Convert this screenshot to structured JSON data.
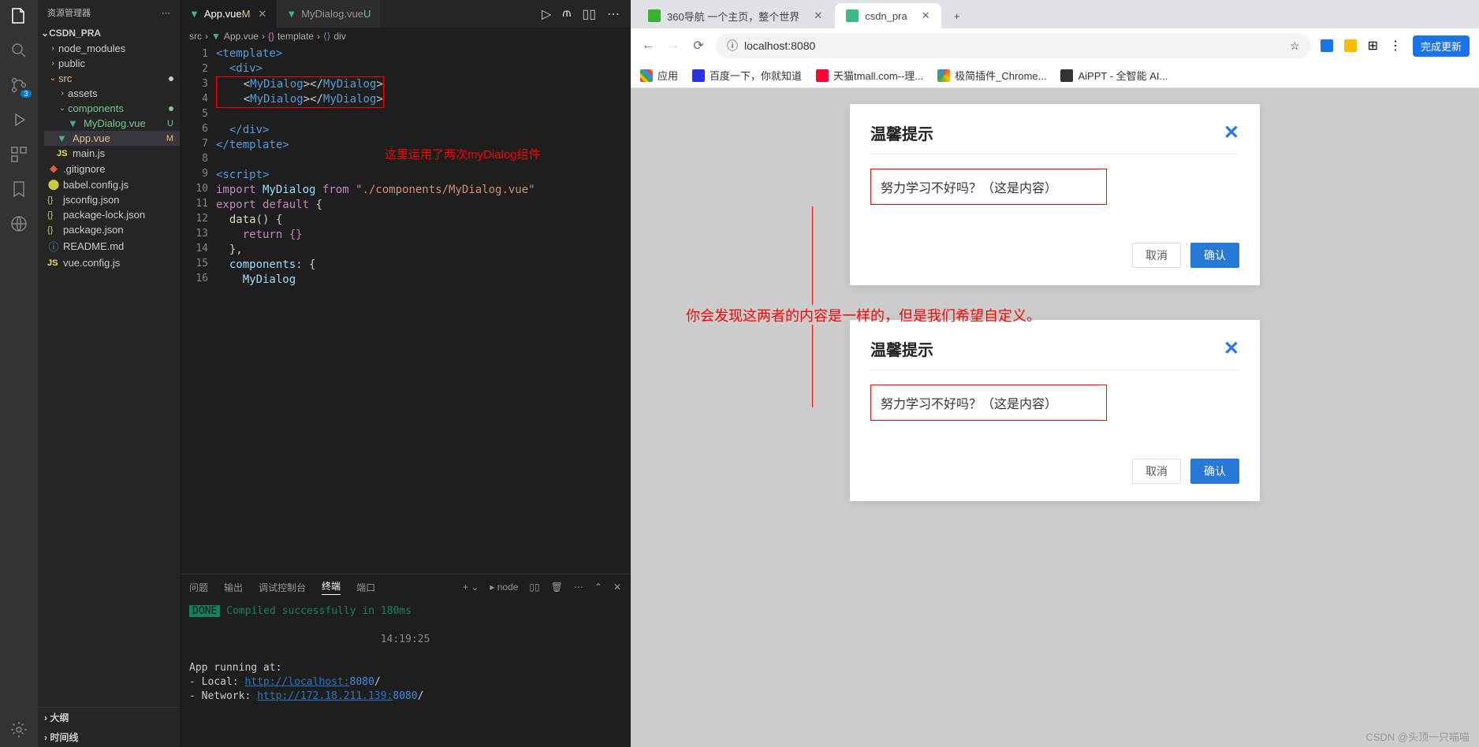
{
  "vscode": {
    "explorer_title": "资源管理器",
    "project_name": "CSDN_PRA",
    "source_control_badge": "3",
    "tree": {
      "node_modules": "node_modules",
      "public": "public",
      "src": "src",
      "assets": "assets",
      "components": "components",
      "mydialog": "MyDialog.vue",
      "mydialog_status": "U",
      "appvue": "App.vue",
      "appvue_status": "M",
      "mainjs": "main.js",
      "gitignore": ".gitignore",
      "babel": "babel.config.js",
      "jsconfig": "jsconfig.json",
      "packagelock": "package-lock.json",
      "packagejson": "package.json",
      "readme": "README.md",
      "vueconfig": "vue.config.js"
    },
    "bottom": {
      "outline": "大纲",
      "timeline": "时间线"
    },
    "tabs": {
      "app": "App.vue",
      "app_status": "M",
      "mydialog": "MyDialog.vue",
      "mydialog_status": "U"
    },
    "breadcrumb": {
      "src": "src",
      "app": "App.vue",
      "tpl": "template",
      "div": "div"
    },
    "code": {
      "l1": "<template>",
      "l2": "  <div>",
      "l3a": "    <",
      "l3b": "MyDialog",
      "l3c": "></",
      "l3d": "MyDialog",
      "l3e": ">",
      "l4a": "    <",
      "l4b": "MyDialog",
      "l4c": "></",
      "l4d": "MyDialog",
      "l4e": ">",
      "l5": "",
      "l6": "  </div>",
      "l7": "</template>",
      "l9": "<script>",
      "l10a": "import",
      "l10b": " MyDialog ",
      "l10c": "from",
      "l10d": " \"./components/MyDialog.vue\"",
      "l11a": "export default",
      "l11b": " {",
      "l12a": "  data",
      "l12b": "() {",
      "l13": "    return {}",
      "l14": "  },",
      "l15a": "  components",
      "l15b": ": {",
      "l16": "    MyDialog"
    },
    "annotation_editor": "这里运用了两次myDialog组件",
    "terminal": {
      "tabs": {
        "problems": "问题",
        "output": "输出",
        "debug": "调试控制台",
        "term": "终端",
        "ports": "端口"
      },
      "shell": "node",
      "done": "DONE",
      "compiled": " Compiled successfully in 180ms",
      "time": "14:19:25",
      "running": "App running at:",
      "local_label": "- Local:   ",
      "local_url": "http://localhost:",
      "local_port": "8080",
      "net_label": "- Network: ",
      "net_url": "http://172.18.211.139:",
      "net_port": "8080"
    }
  },
  "browser": {
    "tabs": {
      "tab1": "360导航 一个主页，整个世界",
      "tab2": "csdn_pra"
    },
    "url": "localhost:8080",
    "update": "完成更新",
    "bookmarks": {
      "apps": "应用",
      "baidu": "百度一下，你就知道",
      "tmall": "天猫tmall.com--理...",
      "chrome": "极简插件_Chrome...",
      "aippt": "AiPPT - 全智能 AI..."
    },
    "annotation_main": "你会发现这两者的内容是一样的，但是我们希望自定义。",
    "dialog": {
      "title": "温馨提示",
      "body": "努力学习不好吗？（这是内容）",
      "cancel": "取消",
      "confirm": "确认"
    },
    "watermark": "CSDN @头顶一只喵喵"
  }
}
